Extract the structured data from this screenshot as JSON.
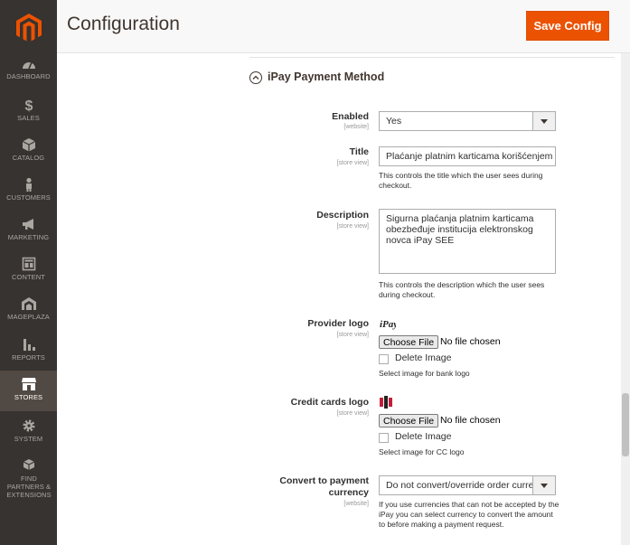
{
  "colors": {
    "sidebar": "#373330",
    "accent": "#eb5202",
    "active_nav": "#514943"
  },
  "nav": [
    {
      "label": "DASHBOARD",
      "icon": "dashboard-icon"
    },
    {
      "label": "SALES",
      "icon": "dollar-icon"
    },
    {
      "label": "CATALOG",
      "icon": "cube-icon"
    },
    {
      "label": "CUSTOMERS",
      "icon": "person-icon"
    },
    {
      "label": "MARKETING",
      "icon": "megaphone-icon"
    },
    {
      "label": "CONTENT",
      "icon": "content-layout-icon"
    },
    {
      "label": "MAGEPLAZA",
      "icon": "mageplaza-icon"
    },
    {
      "label": "REPORTS",
      "icon": "bar-chart-icon"
    },
    {
      "label": "STORES",
      "icon": "store-icon",
      "active": true
    },
    {
      "label": "SYSTEM",
      "icon": "gear-icon"
    },
    {
      "label": "FIND PARTNERS & EXTENSIONS",
      "icon": "boxes-icon"
    }
  ],
  "header": {
    "title": "Configuration",
    "save_label": "Save Config"
  },
  "section": {
    "title": "iPay Payment Method",
    "fields": {
      "enabled": {
        "label": "Enabled",
        "scope": "[website]",
        "value": "Yes"
      },
      "title": {
        "label": "Title",
        "scope": "[store view]",
        "value": "Plaćanje platnim karticama korišćenjem",
        "note": "This controls the title which the user sees during checkout."
      },
      "description": {
        "label": "Description",
        "scope": "[store view]",
        "value": "Sigurna plaćanja platnim karticama obezbeđuje institucija elektronskog novca iPay SEE",
        "note": "This controls the description which the user sees during checkout."
      },
      "provider_logo": {
        "label": "Provider logo",
        "scope": "[store view]",
        "button": "Choose File",
        "status": "No file chosen",
        "delete_label": "Delete Image",
        "note": "Select image for bank logo"
      },
      "cc_logo": {
        "label": "Credit cards logo",
        "scope": "[store view]",
        "button": "Choose File",
        "status": "No file chosen",
        "delete_label": "Delete Image",
        "note": "Select image for CC logo"
      },
      "currency": {
        "label": "Convert to payment currency",
        "scope": "[website]",
        "value": "Do not convert/override order currency",
        "note": "If you use currencies that can not be accepted by the iPay you can select currency to convert the amount to before making a payment request."
      }
    }
  }
}
